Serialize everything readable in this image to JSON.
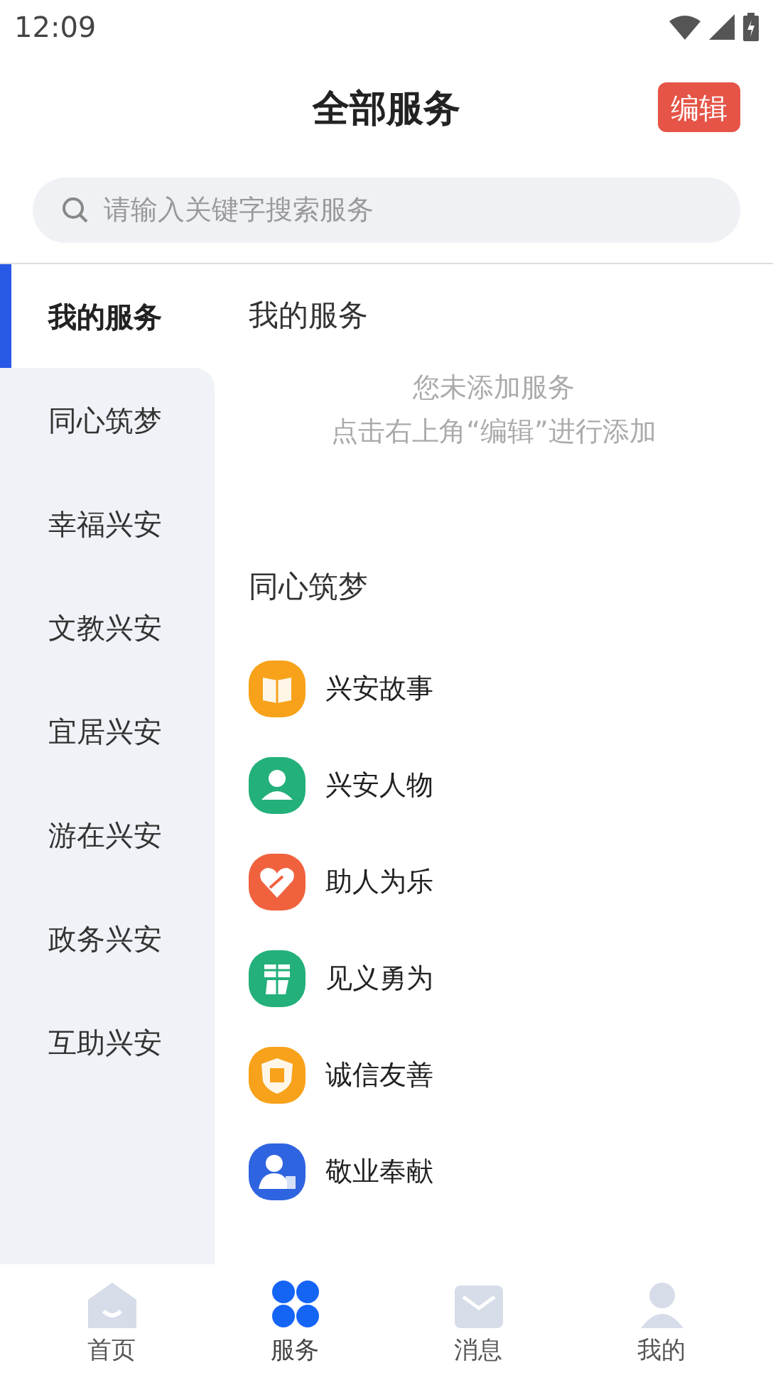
{
  "status_bar": {
    "time": "12:09"
  },
  "header": {
    "title": "全部服务",
    "edit_button": "编辑"
  },
  "search": {
    "placeholder": "请输入关键字搜索服务"
  },
  "sidebar": {
    "items": [
      {
        "label": "我的服务",
        "selected": true
      },
      {
        "label": "同心筑梦",
        "selected": false
      },
      {
        "label": "幸福兴安",
        "selected": false
      },
      {
        "label": "文教兴安",
        "selected": false
      },
      {
        "label": "宜居兴安",
        "selected": false
      },
      {
        "label": "游在兴安",
        "selected": false
      },
      {
        "label": "政务兴安",
        "selected": false
      },
      {
        "label": "互助兴安",
        "selected": false
      }
    ]
  },
  "sections": [
    {
      "title": "我的服务",
      "empty_lines": [
        "您未添加服务",
        "点击右上角“编辑”进行添加"
      ]
    },
    {
      "title": "同心筑梦",
      "services": [
        {
          "label": "兴安故事",
          "kind": "book"
        },
        {
          "label": "兴安人物",
          "kind": "person"
        },
        {
          "label": "助人为乐",
          "kind": "heart"
        },
        {
          "label": "见义勇为",
          "kind": "brave"
        },
        {
          "label": "诚信友善",
          "kind": "shield"
        },
        {
          "label": "敬业奉献",
          "kind": "worker"
        }
      ]
    }
  ],
  "tab_bar": [
    {
      "label": "首页",
      "kind": "home",
      "selected": false
    },
    {
      "label": "服务",
      "kind": "grid",
      "selected": true
    },
    {
      "label": "消息",
      "kind": "message",
      "selected": false
    },
    {
      "label": "我的",
      "kind": "profile",
      "selected": false
    }
  ]
}
